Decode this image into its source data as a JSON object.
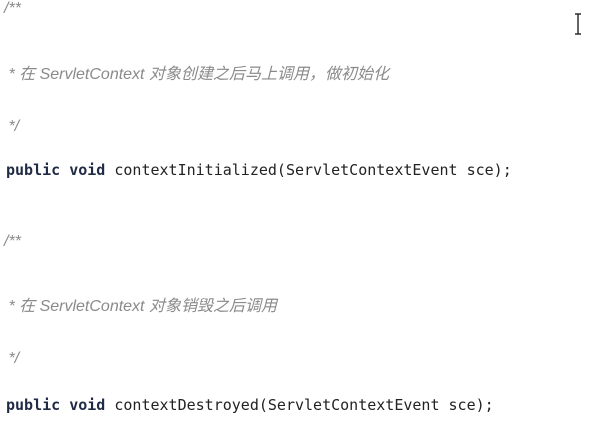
{
  "editor": {
    "blocks": [
      {
        "comment_open": "/**",
        "comment_body": " * 在 ServletContext 对象创建之后马上调用，做初始化",
        "comment_close": " */",
        "modifier": "public",
        "return_type": "void",
        "signature": "contextInitialized(ServletContextEvent sce);"
      },
      {
        "comment_open": "/**",
        "comment_body": " * 在 ServletContext 对象销毁之后调用",
        "comment_close": " */",
        "modifier": "public",
        "return_type": "void",
        "signature": "contextDestroyed(ServletContextEvent sce);"
      }
    ],
    "cursor_icon": "text-cursor-icon"
  }
}
